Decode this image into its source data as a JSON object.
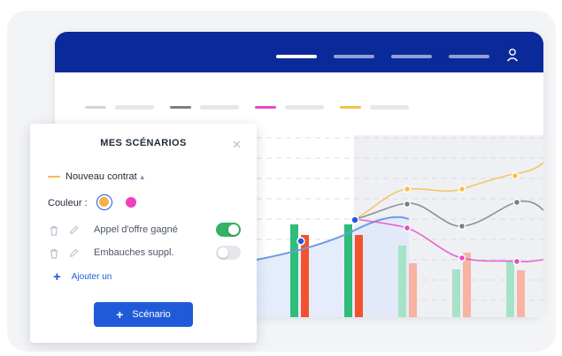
{
  "nav": {
    "items": [
      {
        "name": "nav-item-1",
        "active": true
      },
      {
        "name": "nav-item-2",
        "active": false
      },
      {
        "name": "nav-item-3",
        "active": false
      },
      {
        "name": "nav-item-4",
        "active": false
      }
    ],
    "user_icon": "user-icon"
  },
  "legend": {
    "colors": [
      "#cfd5df",
      "#7a7f87",
      "#e84ac4",
      "#f5c04a"
    ]
  },
  "panel": {
    "title": "MES SCÉNARIOS",
    "close_icon": "close-icon",
    "contract": {
      "label": "Nouveau contrat",
      "color": "#f7b955",
      "caret_icon": "caret-up-icon"
    },
    "color_label": "Couleur :",
    "colors": {
      "selected": "#f5b04a",
      "alternate": "#f03fbf"
    },
    "options": [
      {
        "label": "Appel d'offre gagné",
        "enabled": true
      },
      {
        "label": "Embauches suppl.",
        "enabled": false
      }
    ],
    "add_label": "Ajouter un",
    "scenario_button": "Scénario"
  },
  "colors": {
    "header": "#0b2a9a",
    "accent": "#1f5bd8",
    "toggle_on": "#34b366",
    "bar_green": "#2ebd7a",
    "bar_red": "#f4522e",
    "bar_green_light": "#a6e3c6",
    "bar_red_light": "#f8b3a3",
    "line_yellow": "#f5c04a",
    "line_gray": "#7a7f87",
    "line_pink": "#e84ac4",
    "line_blue": "#6f9ae0"
  }
}
